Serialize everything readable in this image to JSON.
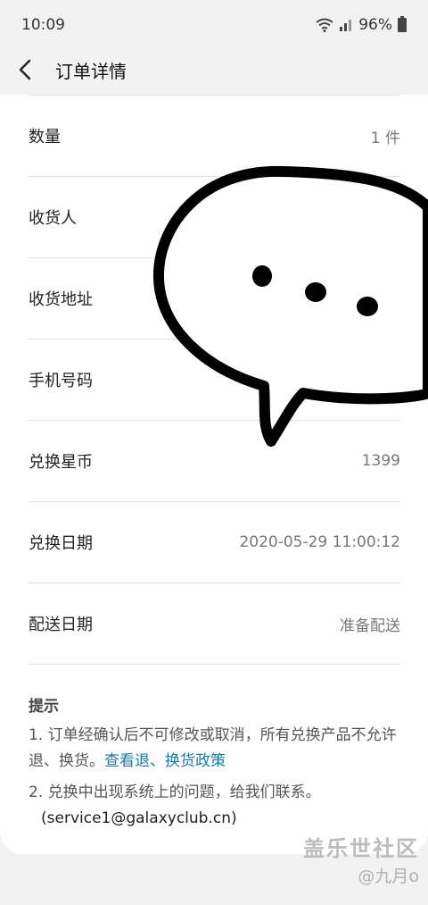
{
  "status": {
    "time": "10:09",
    "battery": "96%"
  },
  "header": {
    "title": "订单详情"
  },
  "rows": [
    {
      "label": "数量",
      "value": "1 件"
    },
    {
      "label": "收货人",
      "value": ""
    },
    {
      "label": "收货地址",
      "value": ""
    },
    {
      "label": "手机号码",
      "value": ""
    },
    {
      "label": "兑换星币",
      "value": "1399"
    },
    {
      "label": "兑换日期",
      "value": "2020-05-29 11:00:12"
    },
    {
      "label": "配送日期",
      "value": "准备配送"
    }
  ],
  "tips": {
    "title": "提示",
    "tip1_text": "1. 订单经确认后不可修改或取消，所有兑换产品不允许退、换货。",
    "tip1_link": "查看退、换货政策",
    "tip2_text": "2. 兑换中出现系统上的问题，给我们联系。",
    "tip2_email": "(service1@galaxyclub.cn)"
  },
  "watermark": {
    "logo": "盖乐世社区",
    "user": "@九月o"
  }
}
